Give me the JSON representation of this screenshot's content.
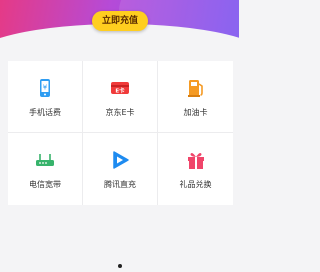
{
  "banner": {
    "cta_label": "立即充值",
    "gradient": [
      "#e53a86",
      "#b54bd8",
      "#7b53f0"
    ],
    "cta_color": "#ffce1f"
  },
  "services": [
    {
      "label": "手机话费",
      "icon": "mobile-phone-icon",
      "color": "#2f9df2"
    },
    {
      "label": "京东E卡",
      "icon": "jd-ecard-icon",
      "color": "#f03a3a"
    },
    {
      "label": "加油卡",
      "icon": "fuel-pump-icon",
      "color": "#f59a23"
    },
    {
      "label": "电信宽带",
      "icon": "router-icon",
      "color": "#37b36b"
    },
    {
      "label": "腾讯直充",
      "icon": "play-icon",
      "color": "#1e8bf0"
    },
    {
      "label": "礼品兑换",
      "icon": "gift-icon",
      "color": "#f0456a"
    }
  ],
  "pager": {
    "pages": 1,
    "active": 1
  }
}
